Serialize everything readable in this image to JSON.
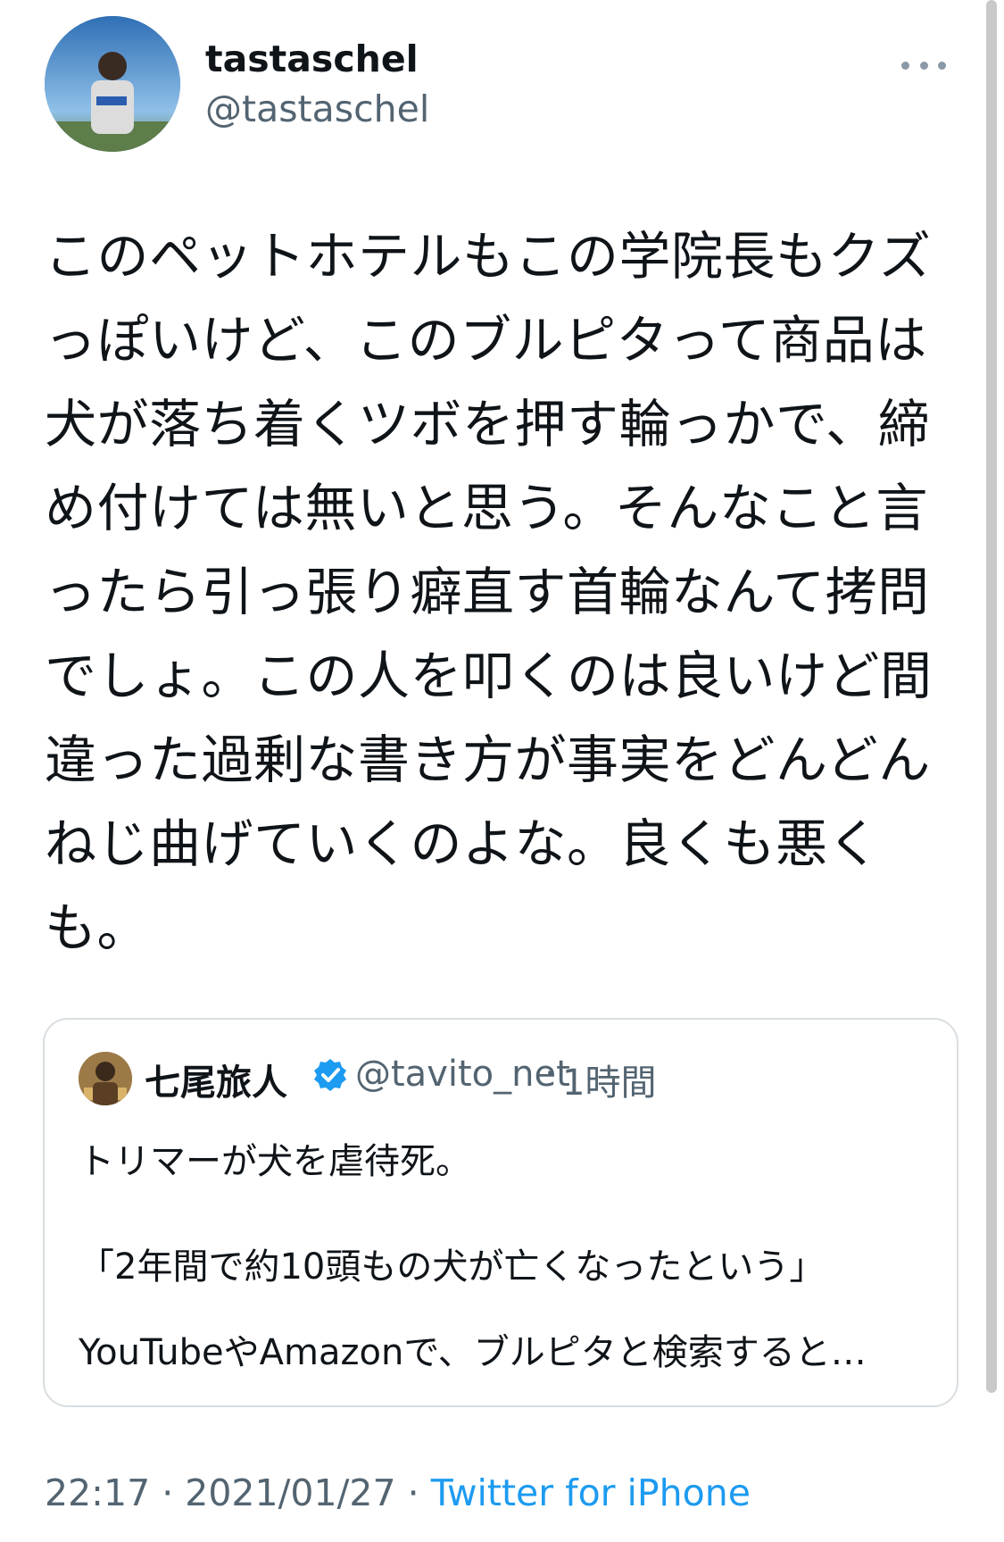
{
  "author": {
    "name": "tastaschel",
    "handle": "@tastaschel"
  },
  "tweet": {
    "text": "このペットホテルもこの学院長もクズっぽいけど、このブルピタって商品は犬が落ち着くツボを押す輪っかで、締め付けては無いと思う。そんなこと言ったら引っ張り癖直す首輪なんて拷問でしょ。この人を叩くのは良いけど間違った過剰な書き方が事実をどんどんねじ曲げていくのよな。良くも悪くも。"
  },
  "quote": {
    "name": "七尾旅人",
    "handle": "@tavito_net",
    "separator": "·",
    "time": "1時間",
    "line1": "トリマーが犬を虐待死。",
    "line2": "「2年間で約10頭もの犬が亡くなったという」",
    "line3": "YouTubeやAmazonで、ブルピタと検索すると…",
    "verified_icon": "verified-badge-icon"
  },
  "meta": {
    "time": "22:17",
    "sep1": " · ",
    "date": "2021/01/27",
    "sep2": " · ",
    "source": "Twitter for iPhone"
  },
  "colors": {
    "text": "#0f1419",
    "secondary": "#536471",
    "link": "#1d9bf0",
    "border": "#d9dee2"
  }
}
